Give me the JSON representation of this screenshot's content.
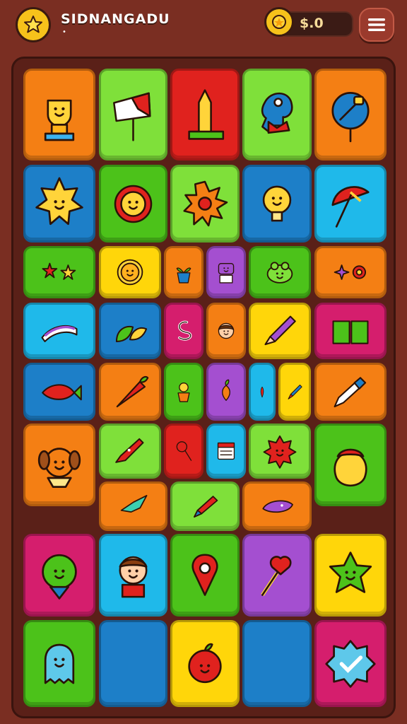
{
  "header": {
    "title": "SIDNANGADU",
    "subtitle": "•",
    "coins": "$.0",
    "logo_icon": "star-icon",
    "coin_icon": "coin-icon",
    "menu_icon": "hamburger-menu-icon"
  },
  "colors": {
    "orange": "#f47f14",
    "green": "#4cc21a",
    "lime": "#7fe03a",
    "red": "#e0221e",
    "blue": "#1d7fc8",
    "cyan": "#1fb9ea",
    "yellow": "#ffd60a",
    "magenta": "#d51e6d",
    "purple": "#a44fd0"
  },
  "board": {
    "tiles": [
      {
        "icon": "trophy-icon",
        "color": "orange"
      },
      {
        "icon": "signpost-icon",
        "color": "lime"
      },
      {
        "icon": "tower-icon",
        "color": "red"
      },
      {
        "icon": "elephant-icon",
        "color": "lime"
      },
      {
        "icon": "bird-sign-icon",
        "color": "orange"
      },
      {
        "icon": "sun-face-icon",
        "color": "blue"
      },
      {
        "icon": "flower-face-icon",
        "color": "green"
      },
      {
        "icon": "sun-icon",
        "color": "lime"
      },
      {
        "icon": "lightbulb-icon",
        "color": "blue"
      },
      {
        "icon": "umbrella-icon",
        "color": "cyan"
      },
      {
        "icon": "stars-icon",
        "color": "green"
      },
      {
        "icon": "smiley-icon",
        "color": "yellow"
      },
      {
        "icon": "plant-pot-icon",
        "color": "orange"
      },
      {
        "icon": "robot-icon",
        "color": "purple"
      },
      {
        "icon": "frog-icon",
        "color": "green"
      },
      {
        "icon": "sparkles-icon",
        "color": "orange"
      },
      {
        "icon": "wave-icon",
        "color": "cyan"
      },
      {
        "icon": "leaf-icon",
        "color": "blue"
      },
      {
        "icon": "hook-icon",
        "color": "magenta"
      },
      {
        "icon": "girl-face-icon",
        "color": "orange"
      },
      {
        "icon": "pencil-icon",
        "color": "yellow"
      },
      {
        "icon": "book-icon",
        "color": "magenta"
      },
      {
        "icon": "fish-icon",
        "color": "blue"
      },
      {
        "icon": "carrot-icon",
        "color": "orange"
      },
      {
        "icon": "potted-flower-icon",
        "color": "green"
      },
      {
        "icon": "radish-icon",
        "color": "purple"
      },
      {
        "icon": "chili-icon",
        "color": "cyan"
      },
      {
        "icon": "pen-icon",
        "color": "yellow"
      },
      {
        "icon": "crayon-icon",
        "color": "orange"
      },
      {
        "icon": "puppy-face-icon",
        "color": "orange"
      },
      {
        "icon": "rocket-candy-icon",
        "color": "lime"
      },
      {
        "icon": "lollipop-icon",
        "color": "red"
      },
      {
        "icon": "calendar-icon",
        "color": "cyan"
      },
      {
        "icon": "red-sun-icon",
        "color": "lime"
      },
      {
        "icon": "berry-icon",
        "color": "green"
      },
      {
        "icon": "fish-arrow-icon",
        "color": "orange"
      },
      {
        "icon": "marker-icon",
        "color": "lime"
      },
      {
        "icon": "whale-icon",
        "color": "orange"
      },
      {
        "icon": "alien-icon",
        "color": "magenta"
      },
      {
        "icon": "boy-icon",
        "color": "cyan"
      },
      {
        "icon": "location-pin-icon",
        "color": "green"
      },
      {
        "icon": "heart-pen-icon",
        "color": "purple"
      },
      {
        "icon": "star-monster-icon",
        "color": "yellow"
      },
      {
        "icon": "ghost-icon",
        "color": "green"
      },
      {
        "icon": "empty-slot",
        "color": "blue"
      },
      {
        "icon": "apple-face-icon",
        "color": "yellow"
      },
      {
        "icon": "empty-slot",
        "color": "blue"
      },
      {
        "icon": "check-badge-icon",
        "color": "magenta"
      }
    ]
  }
}
